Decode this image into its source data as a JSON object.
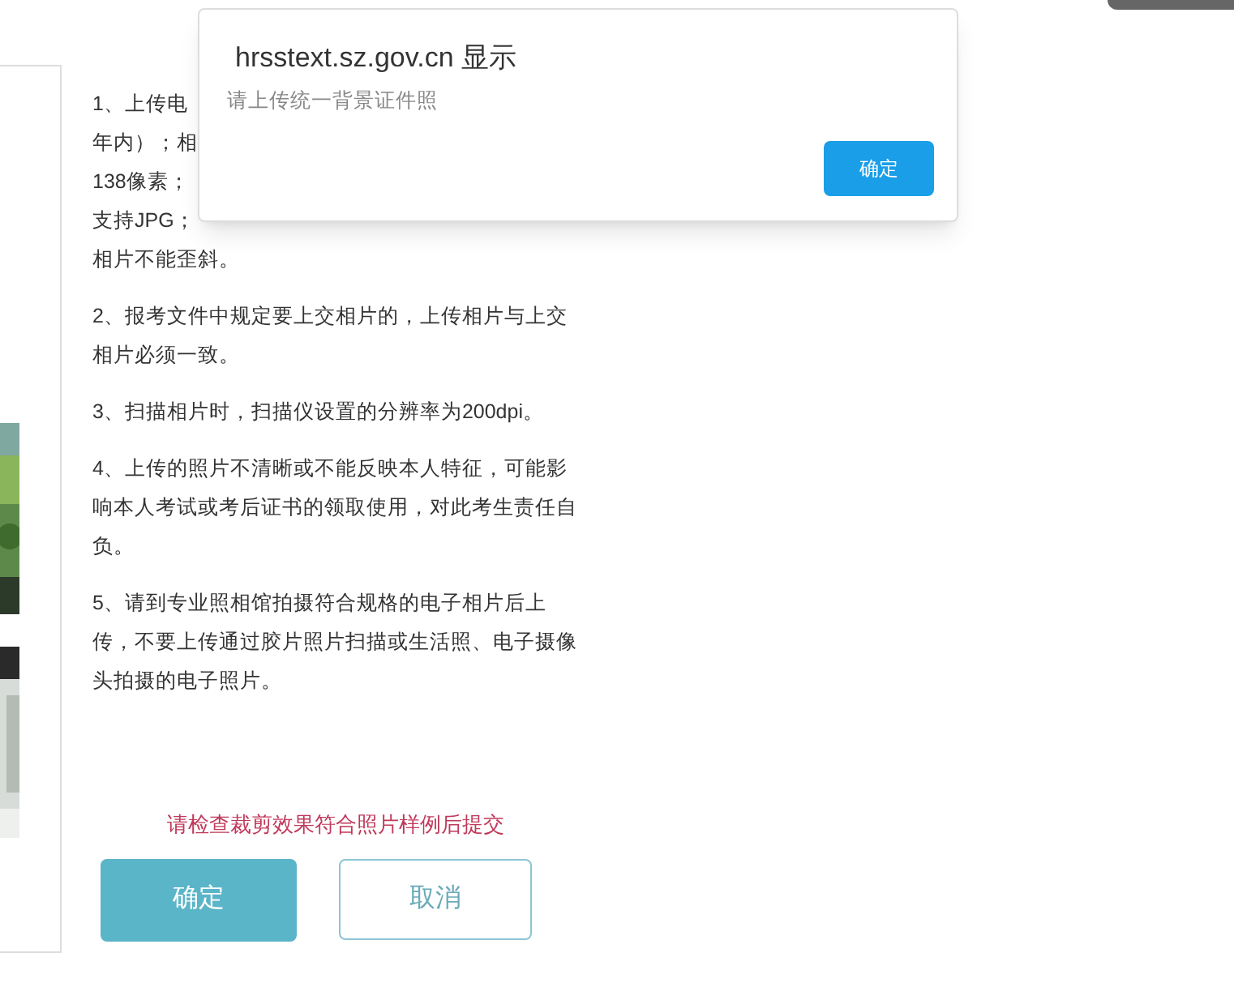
{
  "dialog": {
    "title": "hrsstext.sz.gov.cn 显示",
    "message": "请上传统一背景证件照",
    "button": "确定"
  },
  "instructions": [
    {
      "lines": [
        "1、上传电",
        "年内）；相",
        "138像素；",
        "支持JPG；",
        "相片不能歪斜。"
      ]
    },
    {
      "lines": [
        "2、报考文件中规定要上交相片的，上传相片与上交",
        "相片必须一致。"
      ]
    },
    {
      "lines": [
        "3、扫描相片时，扫描仪设置的分辨率为200dpi。"
      ]
    },
    {
      "lines": [
        "4、上传的照片不清晰或不能反映本人特征，可能影",
        "响本人考试或考后证书的领取使用，对此考生责任自",
        "负。"
      ]
    },
    {
      "lines": [
        "5、请到专业照相馆拍摄符合规格的电子相片后上",
        "传，不要上传通过胶片照片扫描或生活照、电子摄像",
        "头拍摄的电子照片。"
      ]
    }
  ],
  "hint": "请检查裁剪效果符合照片样例后提交",
  "buttons": [
    {
      "label": "确定",
      "kind": "primary"
    },
    {
      "label": "取消",
      "kind": "secondary"
    }
  ]
}
